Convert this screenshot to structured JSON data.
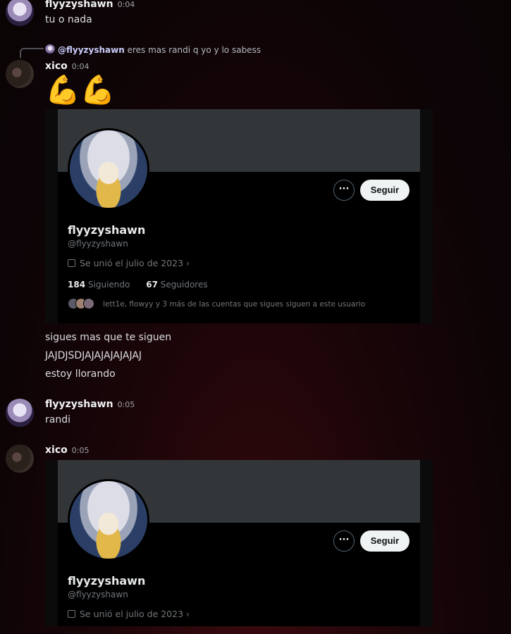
{
  "messages": {
    "m1": {
      "author": "flyyzyshawn",
      "time": "0:04",
      "text": "tu o nada"
    },
    "m2": {
      "reply": {
        "author": "@flyyzyshawn",
        "text": "eres mas randi q yo y lo sabess"
      },
      "author": "xico",
      "time": "0:04",
      "emoji": "💪💪",
      "lines": [
        "sigues mas que te siguen",
        "JAJDJSDJAJAJAJAJAJAJ",
        "estoy llorando"
      ]
    },
    "m3": {
      "author": "flyyzyshawn",
      "time": "0:05",
      "text": "randi"
    },
    "m4": {
      "author": "xico",
      "time": "0:05"
    }
  },
  "profile_card": {
    "more_label": "···",
    "follow_label": "Seguir",
    "name": "flyyzyshawn",
    "handle": "@flyyzyshawn",
    "joined": "Se unió el julio de 2023",
    "following_count": "184",
    "following_label": "Siguiendo",
    "followers_count": "67",
    "followers_label": "Seguidores",
    "followed_by": "lett1e, flowyy y 3 más de las cuentas que sigues siguen a este usuario"
  },
  "icons": [
    "calendar-icon",
    "chevron-right-icon",
    "more-icon"
  ],
  "colors": {
    "card_bg": "#000000",
    "banner": "#333639",
    "follow_btn": "#eff3f4",
    "muted": "#71767b"
  }
}
